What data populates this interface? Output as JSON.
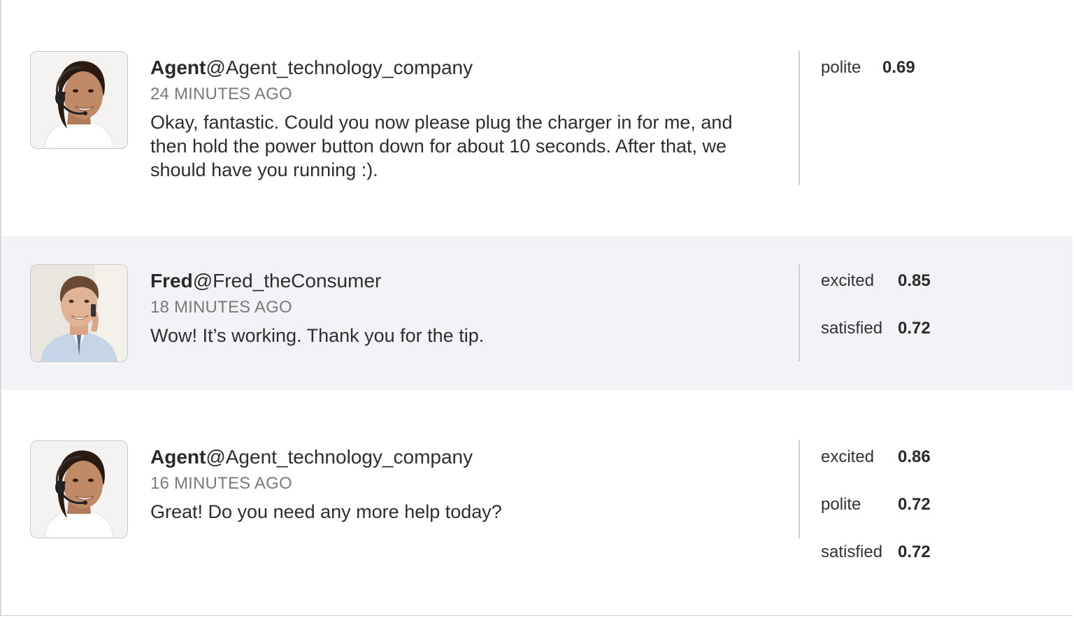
{
  "messages": [
    {
      "author": "Agent",
      "handle": "@Agent_technology_company",
      "time": "24 MINUTES AGO",
      "text": "Okay, fantastic. Could you now please plug the charger in for me, and then hold the power button down for about 10 seconds. After that, we should have you running :).",
      "avatar": "agent-headset",
      "tones": [
        {
          "label": "polite",
          "score": "0.69"
        }
      ]
    },
    {
      "author": "Fred",
      "handle": "@Fred_theConsumer",
      "time": "18 MINUTES AGO",
      "text": "Wow! It’s working. Thank you for the tip.",
      "avatar": "consumer-phone",
      "tones": [
        {
          "label": "excited",
          "score": "0.85"
        },
        {
          "label": "satisfied",
          "score": "0.72"
        }
      ]
    },
    {
      "author": "Agent",
      "handle": "@Agent_technology_company",
      "time": "16 MINUTES AGO",
      "text": "Great! Do you need any more help today?",
      "avatar": "agent-headset",
      "tones": [
        {
          "label": "excited",
          "score": "0.86"
        },
        {
          "label": "polite",
          "score": "0.72"
        },
        {
          "label": "satisfied",
          "score": "0.72"
        }
      ]
    }
  ],
  "colors": {
    "highlight_row": "#f2f2f7",
    "divider": "#cfcfcf",
    "timestamp": "#7a7a7a"
  }
}
